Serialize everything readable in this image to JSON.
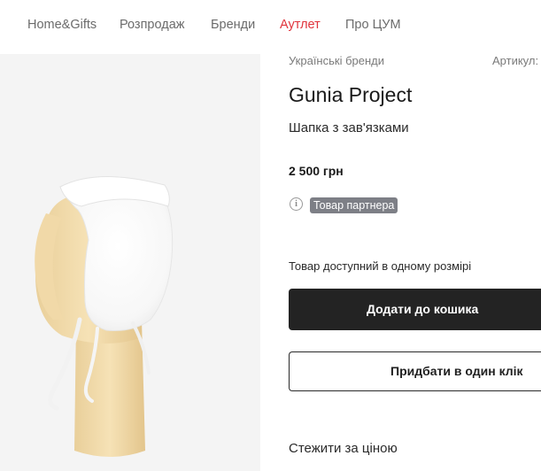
{
  "nav": {
    "items": [
      {
        "label": "Home&Gifts"
      },
      {
        "label": "Розпродаж"
      },
      {
        "label": "Бренди"
      },
      {
        "label": "Аутлет",
        "highlight_color": "#e0343c"
      },
      {
        "label": "Про ЦУМ"
      }
    ]
  },
  "product": {
    "category": "Українські бренди",
    "article_label": "Артикул:",
    "brand": "Gunia Project",
    "name": "Шапка з зав'язками",
    "price": "2 500 грн",
    "partner_badge": "Товар партнера",
    "info_icon": "info-icon",
    "size_note": "Товар доступний в одному розмірі",
    "add_to_cart": "Додати до кошика",
    "buy_one_click": "Придбати в один клік",
    "watch_price": "Стежити за ціною"
  },
  "colors": {
    "accent_outlet": "#e0343c",
    "primary_button": "#232323",
    "badge_bg": "#7d7f86",
    "image_bg": "#f4f4f4"
  }
}
